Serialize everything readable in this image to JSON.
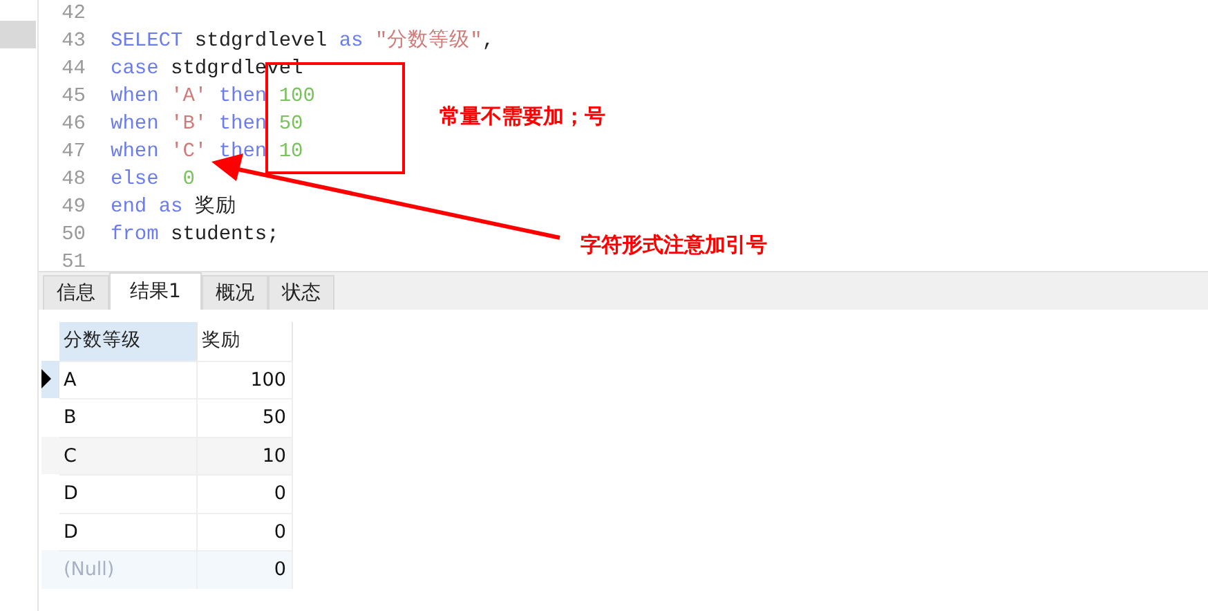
{
  "editor": {
    "lines": [
      {
        "number": "42"
      },
      {
        "number": "43",
        "tokens": [
          {
            "kind": "keyword",
            "text": "SELECT "
          },
          {
            "kind": "plain",
            "text": "stdgrdlevel "
          },
          {
            "kind": "keyword",
            "text": "as "
          },
          {
            "kind": "string",
            "text": "\"分数等级\""
          },
          {
            "kind": "plain",
            "text": ","
          }
        ]
      },
      {
        "number": "44",
        "tokens": [
          {
            "kind": "keyword",
            "text": "case "
          },
          {
            "kind": "plain",
            "text": "stdgrdlevel"
          }
        ]
      },
      {
        "number": "45",
        "tokens": [
          {
            "kind": "keyword",
            "text": "when "
          },
          {
            "kind": "string",
            "text": "'A' "
          },
          {
            "kind": "keyword",
            "text": "then "
          },
          {
            "kind": "number",
            "text": "100"
          }
        ]
      },
      {
        "number": "46",
        "tokens": [
          {
            "kind": "keyword",
            "text": "when "
          },
          {
            "kind": "string",
            "text": "'B' "
          },
          {
            "kind": "keyword",
            "text": "then "
          },
          {
            "kind": "number",
            "text": "50"
          }
        ]
      },
      {
        "number": "47",
        "tokens": [
          {
            "kind": "keyword",
            "text": "when "
          },
          {
            "kind": "string",
            "text": "'C' "
          },
          {
            "kind": "keyword",
            "text": "then "
          },
          {
            "kind": "number",
            "text": "10"
          }
        ]
      },
      {
        "number": "48",
        "tokens": [
          {
            "kind": "keyword",
            "text": "else  "
          },
          {
            "kind": "number",
            "text": "0"
          }
        ]
      },
      {
        "number": "49",
        "tokens": [
          {
            "kind": "keyword",
            "text": "end "
          },
          {
            "kind": "keyword",
            "text": "as "
          },
          {
            "kind": "plain",
            "text": "奖励"
          }
        ]
      },
      {
        "number": "50",
        "tokens": [
          {
            "kind": "keyword",
            "text": "from "
          },
          {
            "kind": "plain",
            "text": "students;"
          }
        ]
      },
      {
        "number": "51"
      }
    ]
  },
  "annotations": [
    {
      "text": "常量不需要加；号"
    },
    {
      "text": "字符形式注意加引号"
    }
  ],
  "tabs": [
    {
      "label": "信息",
      "selected": false
    },
    {
      "label": "结果1",
      "selected": true
    },
    {
      "label": "概况",
      "selected": false
    },
    {
      "label": "状态",
      "selected": false
    }
  ],
  "table": {
    "columns": [
      "分数等级",
      "奖励"
    ],
    "rows": [
      {
        "selected": true,
        "cells": [
          {
            "kind": "text",
            "text": "A"
          },
          {
            "kind": "number",
            "text": "100"
          }
        ]
      },
      {
        "selected": false,
        "cells": [
          {
            "kind": "text",
            "text": "B"
          },
          {
            "kind": "number",
            "text": "50"
          }
        ]
      },
      {
        "selected": false,
        "cells": [
          {
            "kind": "text",
            "text": "C"
          },
          {
            "kind": "number",
            "text": "10"
          }
        ]
      },
      {
        "selected": false,
        "cells": [
          {
            "kind": "text",
            "text": "D"
          },
          {
            "kind": "number",
            "text": "0"
          }
        ]
      },
      {
        "selected": false,
        "cells": [
          {
            "kind": "text",
            "text": "D"
          },
          {
            "kind": "number",
            "text": "0"
          }
        ]
      },
      {
        "selected": false,
        "cells": [
          {
            "kind": "null",
            "text": "(Null)"
          },
          {
            "kind": "number",
            "text": "0"
          }
        ]
      }
    ]
  }
}
